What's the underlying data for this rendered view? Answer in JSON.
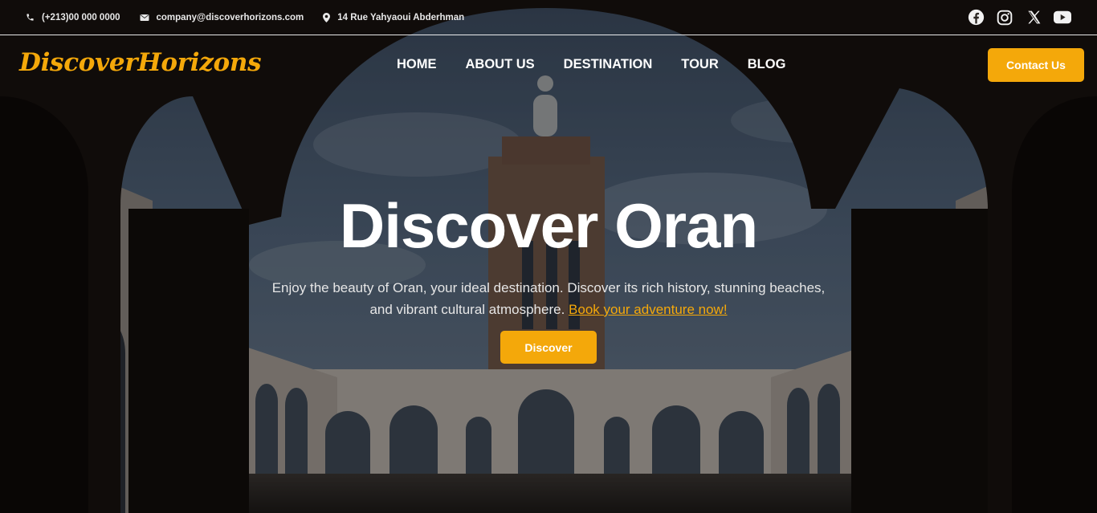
{
  "topbar": {
    "phone": "(+213)00 000 0000",
    "email": "company@discoverhorizons.com",
    "address": "14 Rue Yahyaoui Abderhman",
    "social": [
      {
        "icon": "facebook-icon"
      },
      {
        "icon": "instagram-icon"
      },
      {
        "icon": "x-twitter-icon"
      },
      {
        "icon": "youtube-icon"
      }
    ]
  },
  "header": {
    "logo": "DiscoverHorizons",
    "nav": [
      "HOME",
      "ABOUT US",
      "DESTINATION",
      "TOUR",
      "BLOG"
    ],
    "contact_label": "Contact Us"
  },
  "hero": {
    "title": "Discover Oran",
    "text": "Enjoy the beauty of Oran, your ideal destination. Discover its rich history, stunning beaches, and vibrant cultural atmosphere.",
    "link": "Book your adventure now!",
    "button": "Discover"
  },
  "colors": {
    "accent": "#f4a80a",
    "overlay": "#000000"
  }
}
